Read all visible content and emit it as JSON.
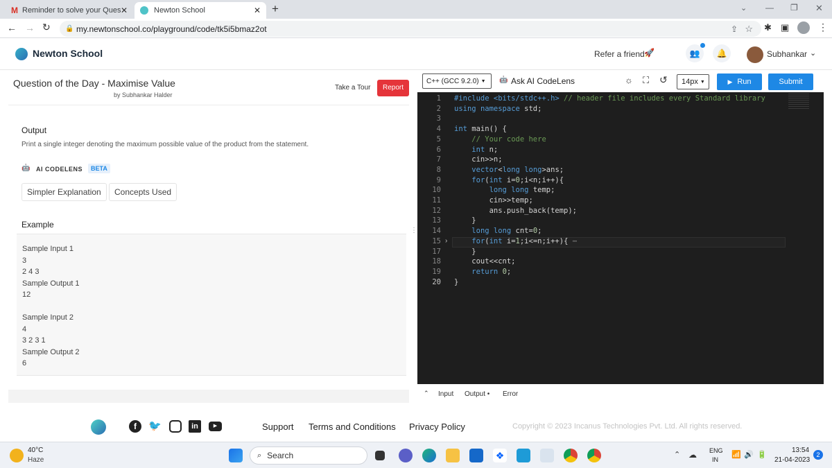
{
  "browser": {
    "tabs": [
      {
        "label": "Reminder to solve your Question",
        "favicon": "gmail-icon"
      },
      {
        "label": "Newton School",
        "favicon": "newton-icon"
      }
    ],
    "url": "my.newtonschool.co/playground/code/tk5i5bmaz2ot"
  },
  "site": {
    "brand": "Newton School",
    "refer": "Refer a friend",
    "user": "Subhankar"
  },
  "question": {
    "title": "Question of the Day - Maximise Value",
    "author": "by Subhankar Halder",
    "tour_label": "Take a Tour",
    "report_label": "Report",
    "output_heading": "Output",
    "output_text": "Print a single integer denoting the maximum possible value of the product from the statement.",
    "codelens_label": "AI CODELENS",
    "beta_label": "BETA",
    "simpler_label": "Simpler Explanation",
    "concepts_label": "Concepts Used",
    "example_heading": "Example",
    "examples": [
      {
        "in_label": "Sample Input 1",
        "in_lines": [
          "3",
          "2 4 3"
        ],
        "out_label": "Sample Output 1",
        "out": "12"
      },
      {
        "in_label": "Sample Input 2",
        "in_lines": [
          "4",
          "3 2 3 1"
        ],
        "out_label": "Sample Output 2",
        "out": "6"
      }
    ]
  },
  "editor": {
    "language": "C++ (GCC 9.2.0)",
    "ask_ai": "Ask AI CodeLens",
    "font_size": "14px",
    "run_label": "Run",
    "submit_label": "Submit",
    "line_numbers": [
      "1",
      "2",
      "3",
      "4",
      "5",
      "6",
      "7",
      "8",
      "9",
      "10",
      "11",
      "12",
      "13",
      "14",
      "15",
      "17",
      "18",
      "19",
      "20"
    ],
    "lines": [
      "#include <bits/stdc++.h> // header file includes every Standard library",
      "using namespace std;",
      "",
      "int main() {",
      "    // Your code here",
      "    int n;",
      "    cin>>n;",
      "    vector<long long>ans;",
      "    for(int i=0;i<n;i++){",
      "        long long temp;",
      "        cin>>temp;",
      "        ans.push_back(temp);",
      "    }",
      "    long long cnt=0;",
      "    for(int i=1;i<=n;i++){ ⋯",
      "    }",
      "    cout<<cnt;",
      "    return 0;",
      "}"
    ],
    "bottom_tabs": [
      "Input",
      "Output •",
      "Error"
    ]
  },
  "footer": {
    "links": [
      "Support",
      "Terms and Conditions",
      "Privacy Policy"
    ],
    "copyright": "Copyright © 2023 Incanus Technologies Pvt. Ltd. All rights reserved."
  },
  "taskbar": {
    "temp": "40°C",
    "weather": "Haze",
    "search": "Search",
    "lang1": "ENG",
    "lang2": "IN",
    "time": "13:54",
    "date": "21-04-2023",
    "notif": "2"
  },
  "colors": {
    "accent": "#1e88e5",
    "report": "#e5343a",
    "editor_bg": "#1e1e1e"
  }
}
